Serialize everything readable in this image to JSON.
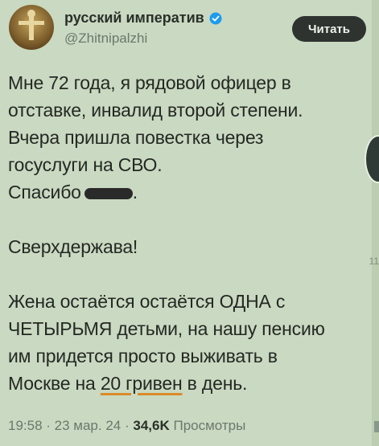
{
  "author": {
    "display_name": "русский императив",
    "handle": "@Zhitnipalzhi"
  },
  "read_button_label": "Читать",
  "tweet": {
    "lines": [
      "Мне 72 года, я рядовой офицер в",
      "отставке, инвалид второй степени.",
      "Вчера пришла повестка через",
      "госуслуги на СВО."
    ],
    "thanks_prefix": "Спасибо",
    "thanks_suffix": ".",
    "superpower": "Сверхдержава!",
    "para3_lines": [
      "Жена остаётся остаётся ОДНА с",
      "ЧЕТЫРЬМЯ детьми, на нашу пенсию",
      "им придется просто выживать в"
    ],
    "last_line_prefix": "Москве на",
    "last_line_underlined": "20 гривен",
    "last_line_suffix": "в день."
  },
  "meta": {
    "time_date": "19:58 · 23 мар. 24 ·",
    "views_count": "34,6K",
    "views_label": "Просмотры"
  },
  "edge_number": "11",
  "colors": {
    "background": "#cad9c1",
    "text": "#242924",
    "muted": "#6b786c",
    "verified": "#1d9bf0",
    "underline": "#d98b2b"
  },
  "icons": {
    "verified": "verified-badge-icon"
  }
}
